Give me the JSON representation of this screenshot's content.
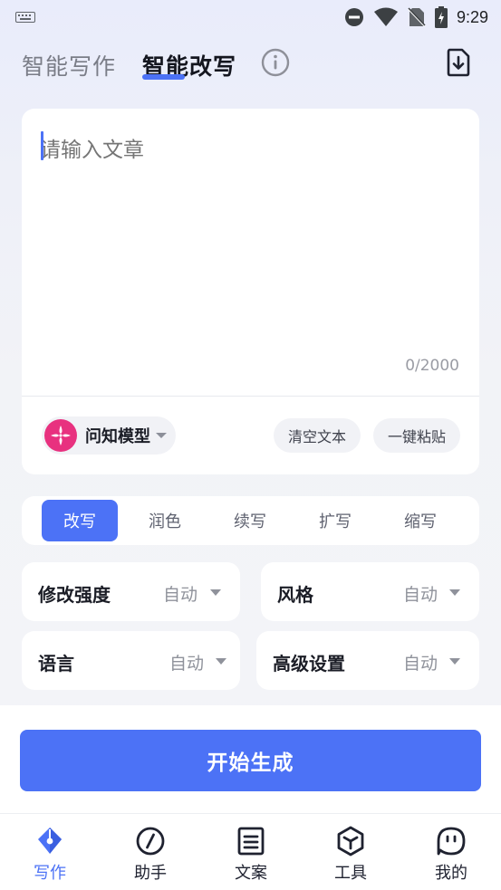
{
  "status_bar": {
    "time": "9:29"
  },
  "header": {
    "tab_writing": "智能写作",
    "tab_rewrite": "智能改写"
  },
  "editor": {
    "placeholder": "请输入文章",
    "counter": "0/2000",
    "model_name": "问知模型",
    "clear_label": "清空文本",
    "paste_label": "一键粘贴"
  },
  "modes": [
    "改写",
    "润色",
    "续写",
    "扩写",
    "缩写"
  ],
  "active_mode": "改写",
  "options": {
    "strength": {
      "label": "修改强度",
      "value": "自动"
    },
    "style": {
      "label": "风格",
      "value": "自动"
    },
    "language": {
      "label": "语言",
      "value": "自动"
    },
    "advanced": {
      "label": "高级设置",
      "value": "自动"
    }
  },
  "start_button": "开始生成",
  "bottom_nav": [
    {
      "label": "写作",
      "icon": "pen-nib-icon",
      "active": true
    },
    {
      "label": "助手",
      "icon": "compass-slash-icon",
      "active": false
    },
    {
      "label": "文案",
      "icon": "document-lines-icon",
      "active": false
    },
    {
      "label": "工具",
      "icon": "cube-icon",
      "active": false
    },
    {
      "label": "我的",
      "icon": "smile-bubble-icon",
      "active": false
    }
  ],
  "colors": {
    "accent": "#4c72f6",
    "model_logo": "#e8317f"
  }
}
